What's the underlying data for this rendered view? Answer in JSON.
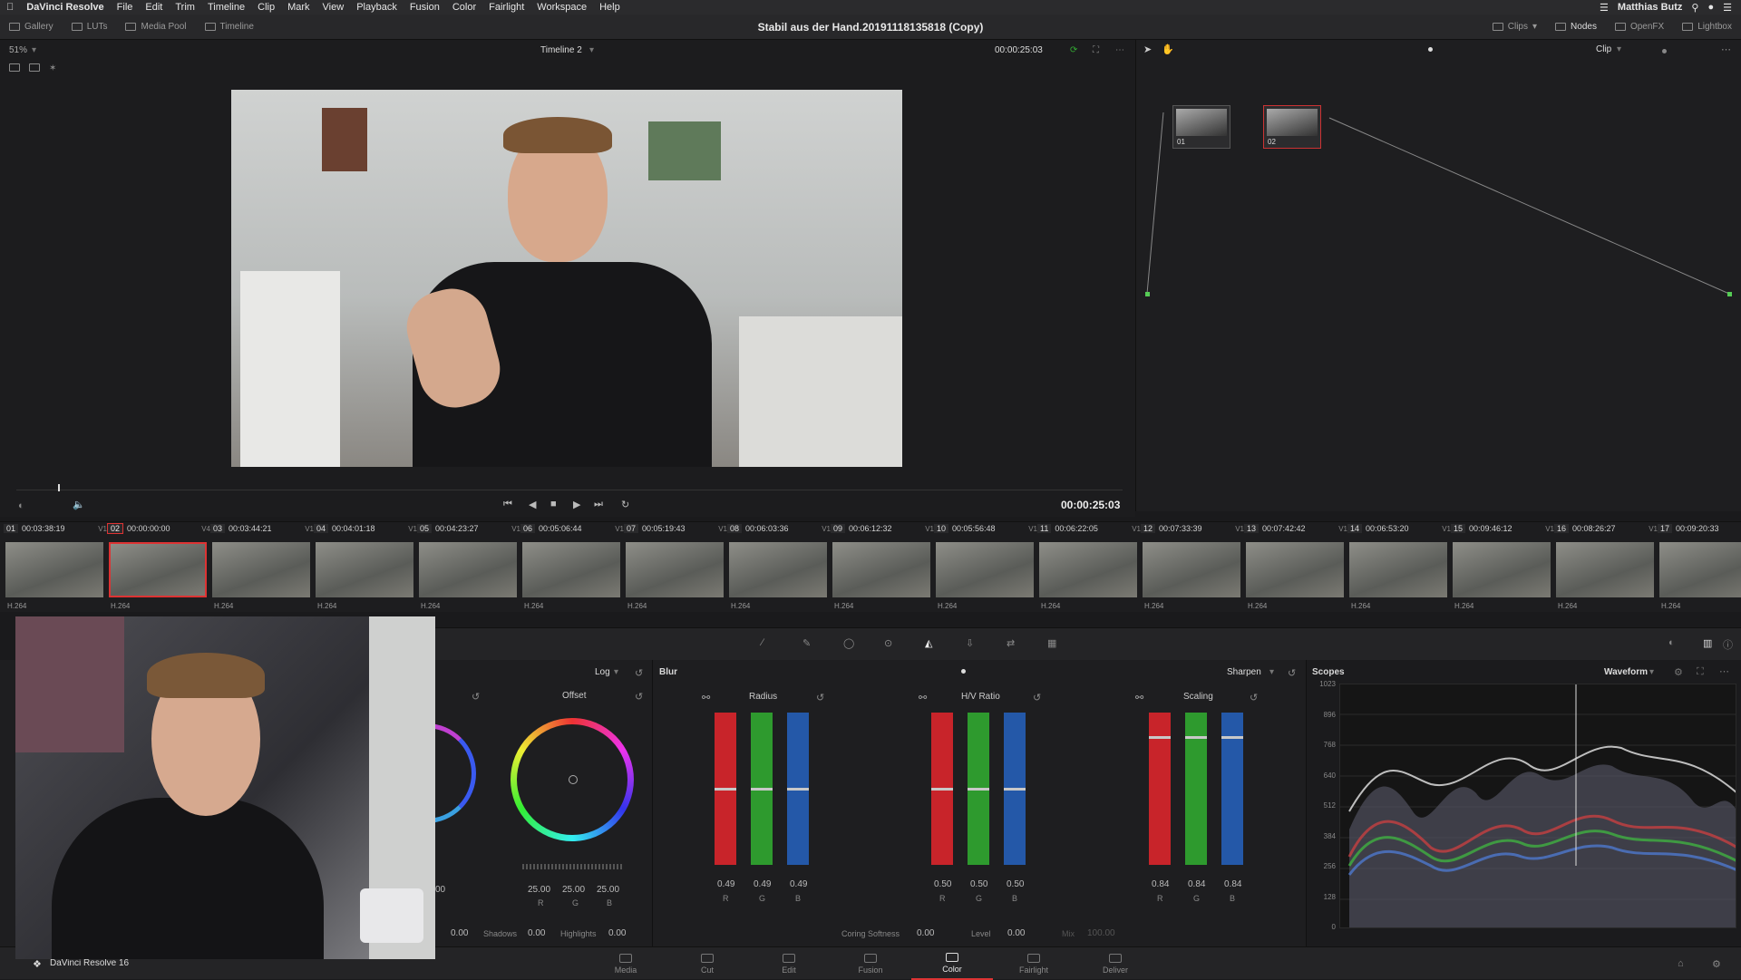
{
  "menubar": {
    "app_name": "DaVinci Resolve",
    "items": [
      "File",
      "Edit",
      "Trim",
      "Timeline",
      "Clip",
      "Mark",
      "View",
      "Playback",
      "Fusion",
      "Color",
      "Fairlight",
      "Workspace",
      "Help"
    ],
    "user": "Matthias Butz"
  },
  "toolbar": {
    "left": [
      "Gallery",
      "LUTs",
      "Media Pool",
      "Timeline"
    ],
    "project_title": "Stabil aus der Hand.20191118135818 (Copy)",
    "right": [
      "Clips",
      "Nodes",
      "OpenFX",
      "Lightbox"
    ]
  },
  "viewer": {
    "zoom": "51%",
    "timeline_name": "Timeline 2",
    "timecode_top": "00:00:25:03",
    "timecode_main": "00:00:25:03",
    "playhead_progress": 0.038
  },
  "node_editor": {
    "mode": "Clip",
    "nodes": [
      {
        "label": "01"
      },
      {
        "label": "02"
      }
    ]
  },
  "clips": [
    {
      "num": "01",
      "tc": "00:03:38:19",
      "track": "V1",
      "codec": "H.264",
      "selected": false
    },
    {
      "num": "02",
      "tc": "00:00:00:00",
      "track": "V4",
      "codec": "H.264",
      "selected": true
    },
    {
      "num": "03",
      "tc": "00:03:44:21",
      "track": "V1",
      "codec": "H.264",
      "selected": false
    },
    {
      "num": "04",
      "tc": "00:04:01:18",
      "track": "V1",
      "codec": "H.264",
      "selected": false
    },
    {
      "num": "05",
      "tc": "00:04:23:27",
      "track": "V1",
      "codec": "H.264",
      "selected": false
    },
    {
      "num": "06",
      "tc": "00:05:06:44",
      "track": "V1",
      "codec": "H.264",
      "selected": false
    },
    {
      "num": "07",
      "tc": "00:05:19:43",
      "track": "V1",
      "codec": "H.264",
      "selected": false
    },
    {
      "num": "08",
      "tc": "00:06:03:36",
      "track": "V1",
      "codec": "H.264",
      "selected": false
    },
    {
      "num": "09",
      "tc": "00:06:12:32",
      "track": "V1",
      "codec": "H.264",
      "selected": false
    },
    {
      "num": "10",
      "tc": "00:05:56:48",
      "track": "V1",
      "codec": "H.264",
      "selected": false
    },
    {
      "num": "11",
      "tc": "00:06:22:05",
      "track": "V1",
      "codec": "H.264",
      "selected": false
    },
    {
      "num": "12",
      "tc": "00:07:33:39",
      "track": "V1",
      "codec": "H.264",
      "selected": false
    },
    {
      "num": "13",
      "tc": "00:07:42:42",
      "track": "V1",
      "codec": "H.264",
      "selected": false
    },
    {
      "num": "14",
      "tc": "00:06:53:20",
      "track": "V1",
      "codec": "H.264",
      "selected": false
    },
    {
      "num": "15",
      "tc": "00:09:46:12",
      "track": "V1",
      "codec": "H.264",
      "selected": false
    },
    {
      "num": "16",
      "tc": "00:08:26:27",
      "track": "V1",
      "codec": "H.264",
      "selected": false
    },
    {
      "num": "17",
      "tc": "00:09:20:33",
      "track": "",
      "codec": "H.264",
      "selected": false
    }
  ],
  "color_wheels": {
    "mode": "Log",
    "offset_label": "Offset",
    "offset_values": [
      "25.00",
      "25.00",
      "25.00"
    ],
    "offset_rgb": [
      "R",
      "G",
      "B"
    ],
    "left_values": [
      "00"
    ],
    "shadows_label": "Shadows",
    "shadows": "0.00",
    "highlights_label": "Highlights",
    "highlights": "0.00",
    "lift_value": "0.00"
  },
  "blur": {
    "title": "Blur",
    "mode": "Sharpen",
    "groups": [
      {
        "label": "Radius",
        "values": [
          "0.49",
          "0.49",
          "0.49"
        ],
        "level": 0.5
      },
      {
        "label": "H/V Ratio",
        "values": [
          "0.50",
          "0.50",
          "0.50"
        ],
        "level": 0.5
      },
      {
        "label": "Scaling",
        "values": [
          "0.84",
          "0.84",
          "0.84"
        ],
        "level": 0.84
      }
    ],
    "rgb": [
      "R",
      "G",
      "B"
    ],
    "coring_label": "Coring Softness",
    "coring": "0.00",
    "level_label": "Level",
    "level": "0.00",
    "mix_label": "Mix",
    "mix": "100.00"
  },
  "scopes": {
    "title": "Scopes",
    "mode": "Waveform",
    "scale": [
      "1023",
      "896",
      "768",
      "640",
      "512",
      "384",
      "256",
      "128",
      "0"
    ]
  },
  "bottom_nav": {
    "app_label": "DaVinci Resolve 16",
    "items": [
      "Media",
      "Cut",
      "Edit",
      "Fusion",
      "Color",
      "Fairlight",
      "Deliver"
    ],
    "active": "Color"
  },
  "colors": {
    "accent": "#d33a3a",
    "red_bar": "#c8242a",
    "green_bar": "#2e9a2e",
    "blue_bar": "#2458a8"
  }
}
